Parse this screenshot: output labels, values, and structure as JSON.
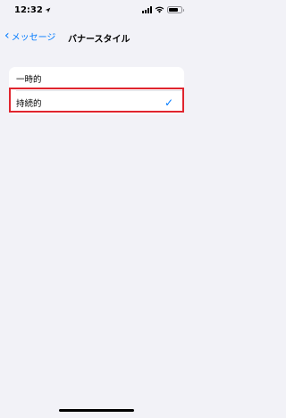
{
  "status_bar": {
    "time": "12:32",
    "location_icon": "location-arrow-icon",
    "icons": [
      "signal-icon",
      "wifi-icon",
      "battery-icon"
    ]
  },
  "nav": {
    "back_label": "メッセージ",
    "title": "バナースタイル"
  },
  "options": [
    {
      "label": "一時的",
      "selected": false
    },
    {
      "label": "持続的",
      "selected": true
    }
  ],
  "colors": {
    "accent": "#007aff",
    "background": "#f2f2f7",
    "highlight": "#e0252e"
  }
}
